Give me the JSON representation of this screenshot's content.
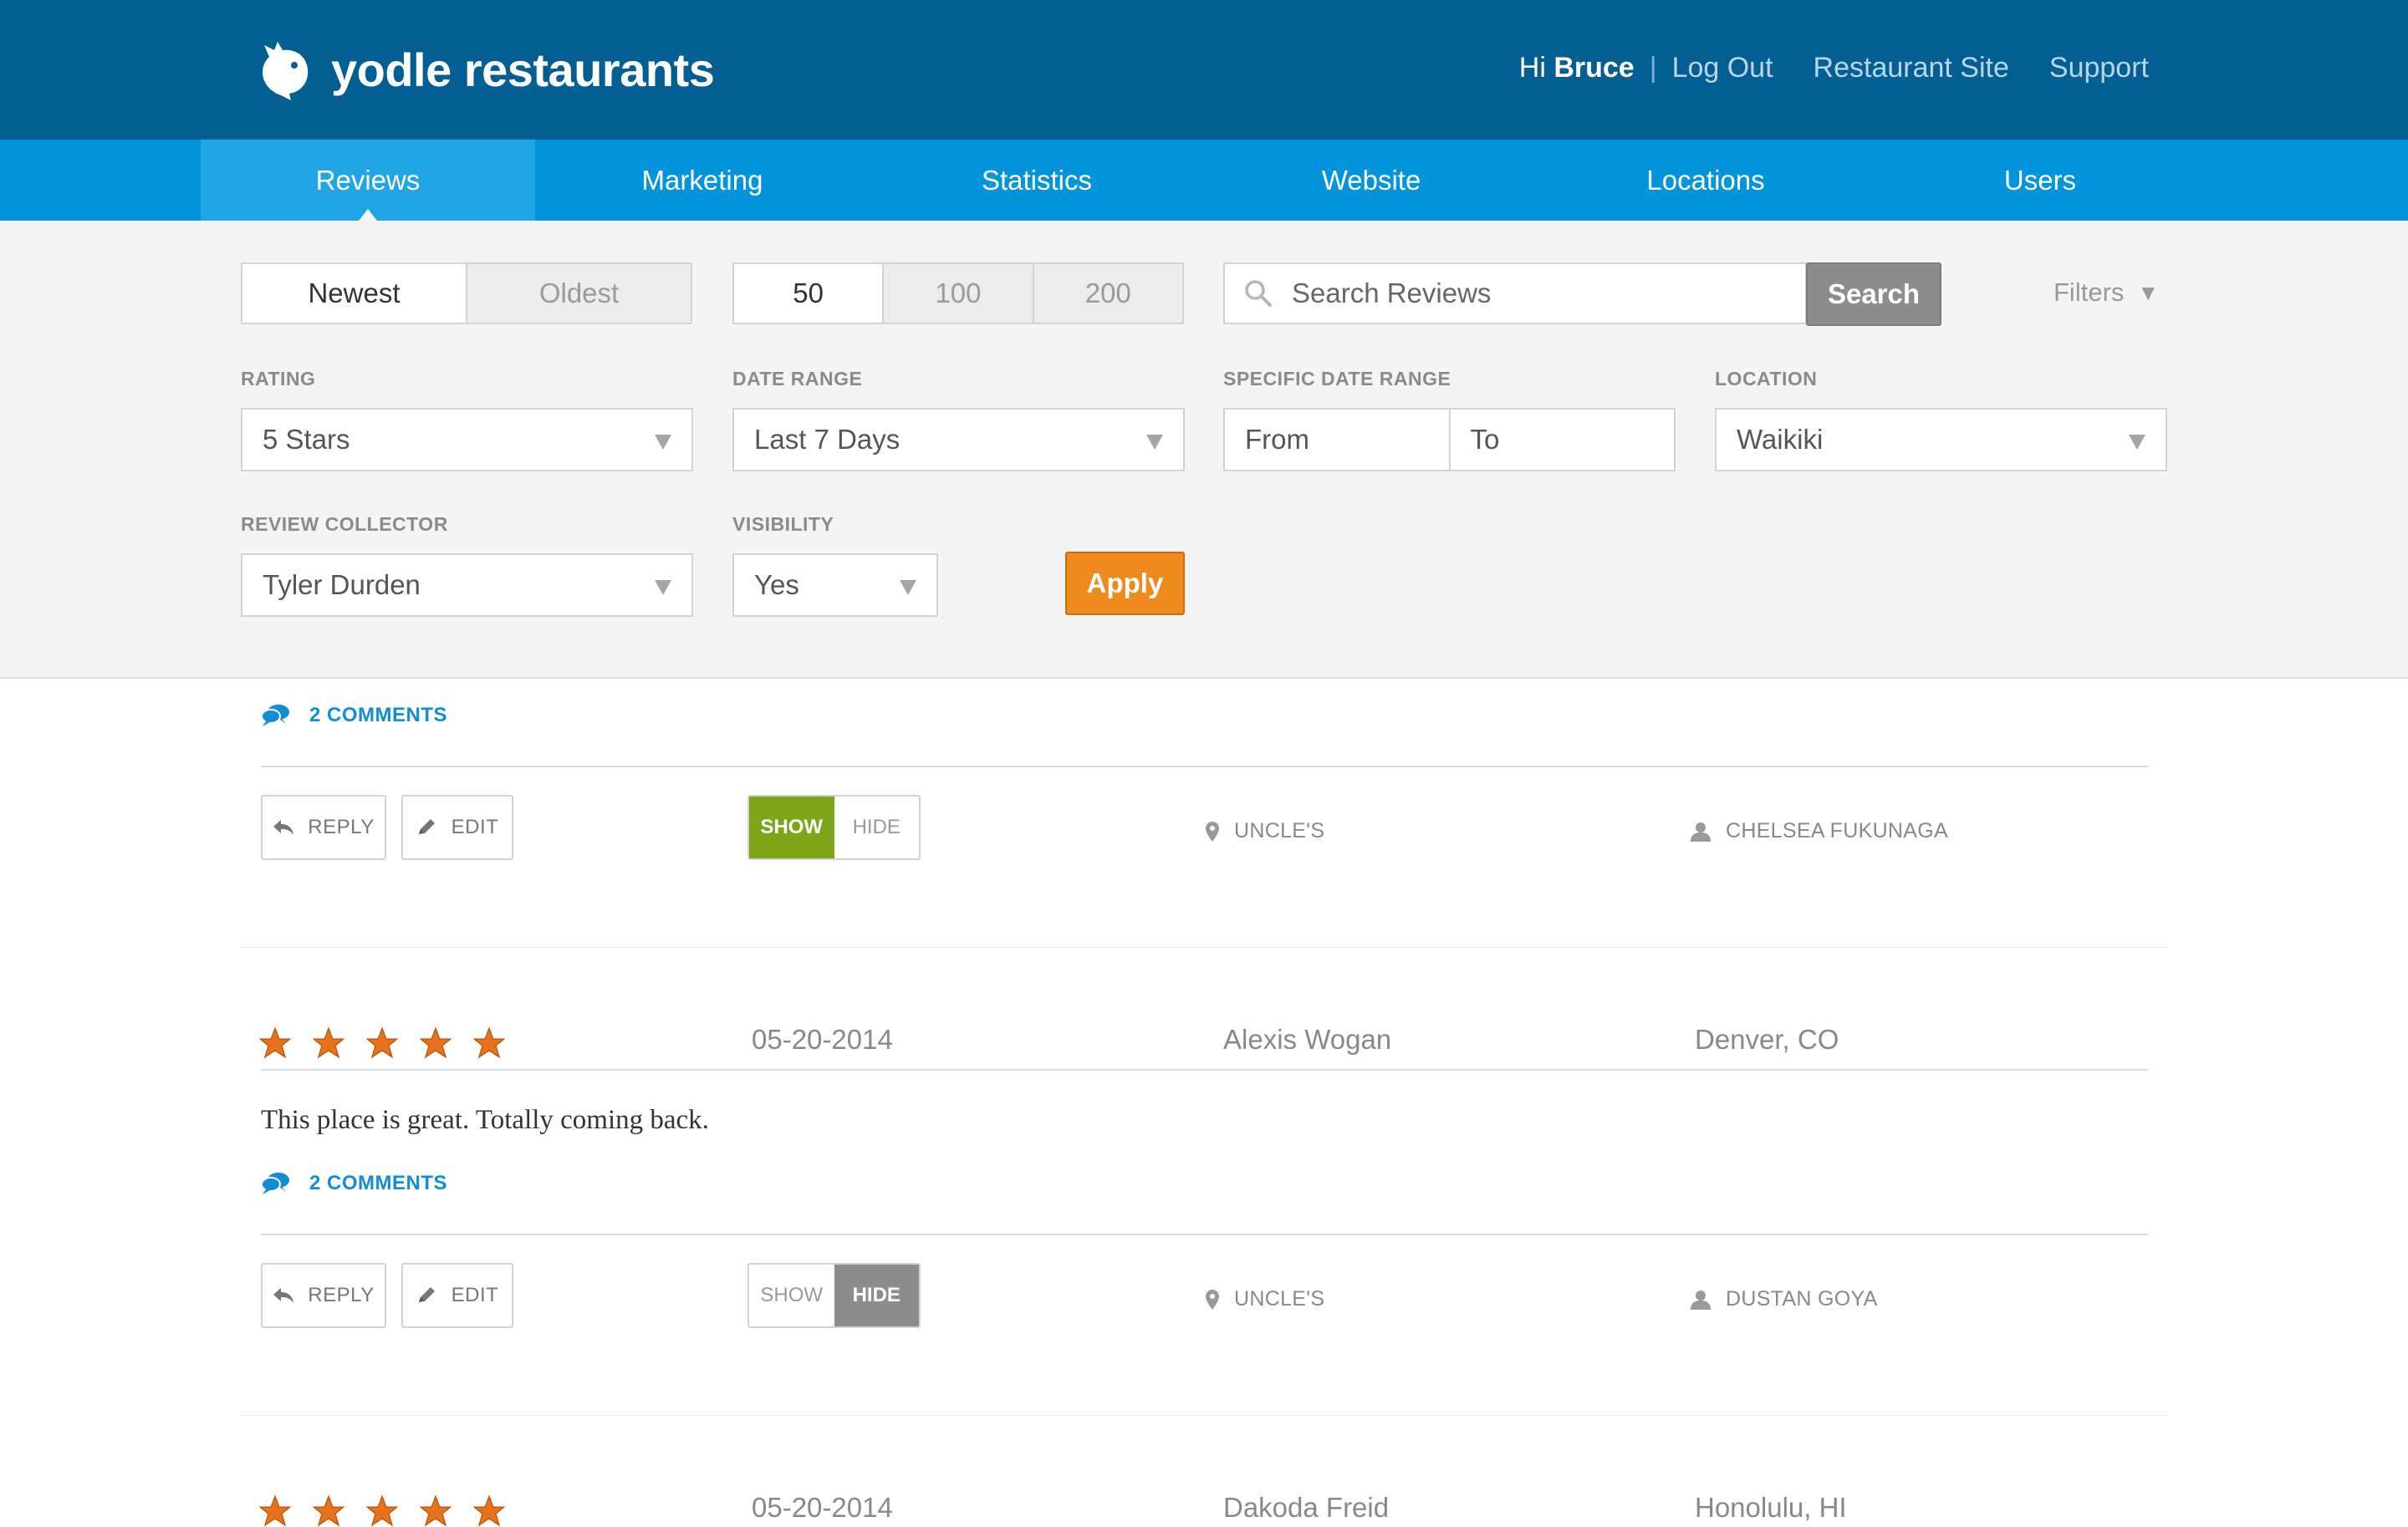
{
  "header": {
    "brand": "yodle restaurants",
    "greeting": "Hi",
    "user_name": "Bruce",
    "separator": "|",
    "logout_label": "Log Out",
    "restaurant_site_label": "Restaurant Site",
    "support_label": "Support"
  },
  "nav": {
    "tabs": [
      {
        "label": "Reviews",
        "active": true
      },
      {
        "label": "Marketing"
      },
      {
        "label": "Statistics"
      },
      {
        "label": "Website"
      },
      {
        "label": "Locations"
      },
      {
        "label": "Users"
      }
    ]
  },
  "filters": {
    "sort": {
      "options": [
        "Newest",
        "Oldest"
      ],
      "selected": "Newest"
    },
    "per_page": {
      "options": [
        "50",
        "100",
        "200"
      ],
      "selected": "50"
    },
    "search": {
      "placeholder": "Search Reviews",
      "button_label": "Search"
    },
    "filters_toggle_label": "Filters",
    "rating": {
      "label": "RATING",
      "value": "5 Stars"
    },
    "date_range": {
      "label": "DATE RANGE",
      "value": "Last 7 Days"
    },
    "specific_date_range": {
      "label": "SPECIFIC DATE RANGE",
      "from": "From",
      "to": "To"
    },
    "location": {
      "label": "LOCATION",
      "value": "Waikiki"
    },
    "review_collector": {
      "label": "REVIEW COLLECTOR",
      "value": "Tyler Durden"
    },
    "visibility": {
      "label": "VISIBILITY",
      "value": "Yes"
    },
    "apply_label": "Apply"
  },
  "reviews": [
    {
      "comments": "2 COMMENTS",
      "reply_label": "REPLY",
      "edit_label": "EDIT",
      "show_label": "SHOW",
      "hide_label": "HIDE",
      "visibility_state": "show",
      "restaurant": "UNCLE'S",
      "collector": "CHELSEA FUKUNAGA"
    },
    {
      "rating": 5,
      "date": "05-20-2014",
      "author": "Alexis Wogan",
      "city": "Denver, CO",
      "text": "This place is great. Totally coming back.",
      "comments": "2 COMMENTS",
      "reply_label": "REPLY",
      "edit_label": "EDIT",
      "show_label": "SHOW",
      "hide_label": "HIDE",
      "visibility_state": "hide",
      "restaurant": "UNCLE'S",
      "collector": "DUSTAN GOYA"
    },
    {
      "rating": 5,
      "date": "05-20-2014",
      "author": "Dakoda Freid",
      "city": "Honolulu, HI"
    }
  ],
  "colors": {
    "header_bg": "#035f93",
    "nav_bg": "#0394db",
    "nav_active": "#22a5e6",
    "apply": "#ee8a1e",
    "show_on": "#7ea418",
    "hide_on": "#8d8d8d",
    "star": "#e8731b",
    "link": "#0f8ed6"
  }
}
